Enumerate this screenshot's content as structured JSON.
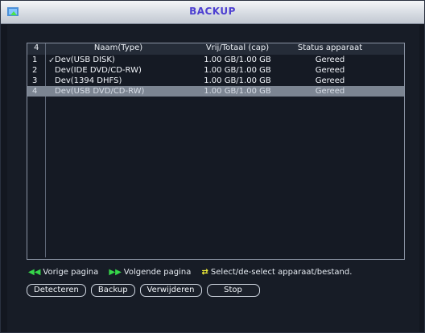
{
  "window": {
    "title": "BACKUP",
    "title_icon": "screen-arrow-icon"
  },
  "table": {
    "columns": [
      "4",
      "Naam(Type)",
      "Vrij/Totaal (cap)",
      "Status apparaat"
    ],
    "rows": [
      {
        "index": "1",
        "checked": true,
        "name": "Dev(USB DISK)",
        "capacity": "1.00 GB/1.00 GB",
        "status": "Gereed",
        "selected": false
      },
      {
        "index": "2",
        "checked": false,
        "name": "Dev(IDE DVD/CD-RW)",
        "capacity": "1.00 GB/1.00 GB",
        "status": "Gereed",
        "selected": false
      },
      {
        "index": "3",
        "checked": false,
        "name": "Dev(1394 DHFS)",
        "capacity": "1.00 GB/1.00 GB",
        "status": "Gereed",
        "selected": false
      },
      {
        "index": "4",
        "checked": false,
        "name": "Dev(USB DVD/CD-RW)",
        "capacity": "1.00 GB/1.00 GB",
        "status": "Gereed",
        "selected": true
      }
    ]
  },
  "legend": {
    "prev_label": "Vorige pagina",
    "next_label": "Volgende pagina",
    "select_label": "Select/de-select apparaat/bestand."
  },
  "buttons": {
    "detect": "Detecteren",
    "backup": "Backup",
    "remove": "Verwijderen",
    "stop": "Stop"
  },
  "colors": {
    "title_text": "#4d3fd1",
    "legend_icon_green": "#36d64a",
    "legend_icon_yellow": "#f1ef39",
    "selected_row": "#7c8592"
  }
}
